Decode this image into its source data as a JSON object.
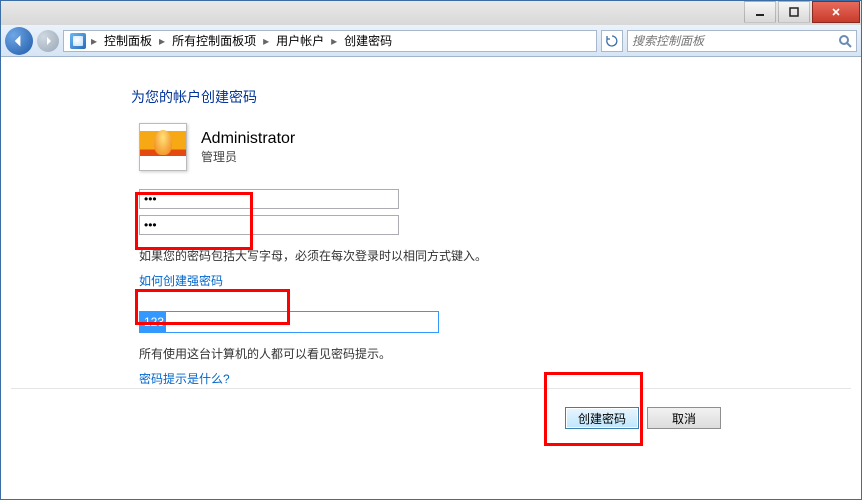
{
  "breadcrumb": {
    "items": [
      "控制面板",
      "所有控制面板项",
      "用户帐户",
      "创建密码"
    ]
  },
  "search": {
    "placeholder": "搜索控制面板"
  },
  "page": {
    "title": "为您的帐户创建密码",
    "user_name": "Administrator",
    "user_role": "管理员",
    "password_value": "•••",
    "confirm_value": "•••",
    "hint_value": "123",
    "caps_note": "如果您的密码包括大写字母，必须在每次登录时以相同方式键入。",
    "strong_link": "如何创建强密码",
    "hint_note": "所有使用这台计算机的人都可以看见密码提示。",
    "what_is_hint_link": "密码提示是什么?"
  },
  "buttons": {
    "create": "创建密码",
    "cancel": "取消"
  }
}
